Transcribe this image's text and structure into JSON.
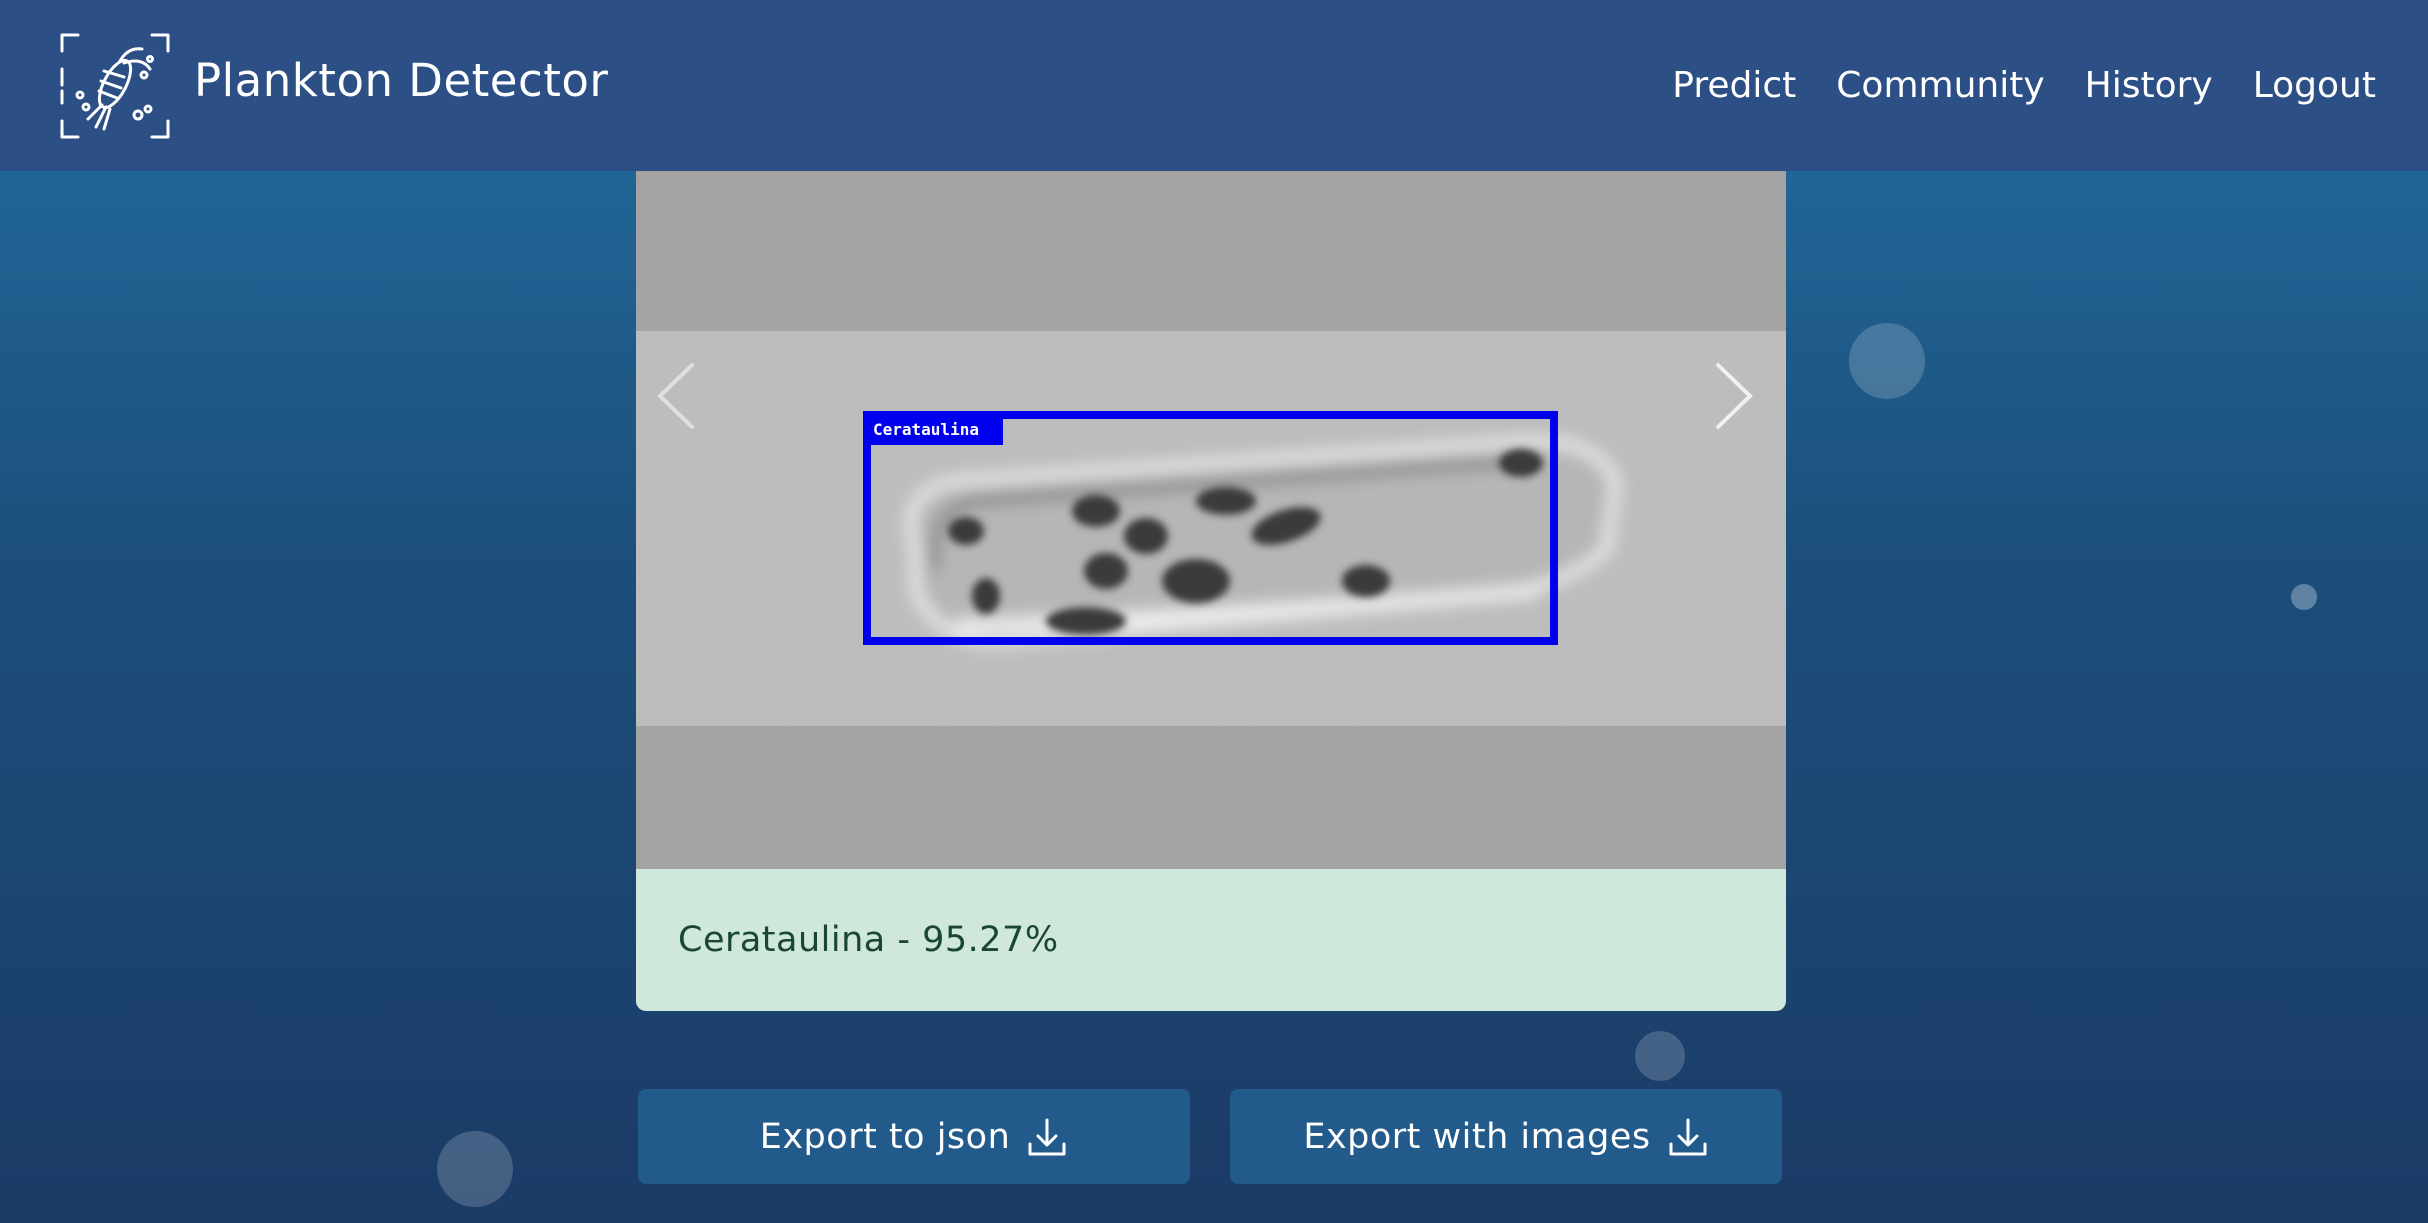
{
  "brand": {
    "title": "Plankton Detector",
    "logo_icon": "plankton-scan-icon"
  },
  "nav": {
    "items": [
      {
        "label": "Predict"
      },
      {
        "label": "Community"
      },
      {
        "label": "History"
      },
      {
        "label": "Logout"
      }
    ]
  },
  "carousel": {
    "detection_label": "Cerataulina",
    "prev_icon": "chevron-left-icon",
    "next_icon": "chevron-right-icon"
  },
  "result": {
    "text": "Cerataulina - 95.27%"
  },
  "actions": {
    "export_json_label": "Export to json",
    "export_images_label": "Export with images",
    "download_icon": "download-icon"
  },
  "colors": {
    "navbar": "#2c4f86",
    "background_top": "#236fa1",
    "background_bottom": "#1b3b66",
    "bbox": "#0000ee",
    "result_bg": "#d0e7dc",
    "result_text": "#1a4733",
    "button": "#225b8b"
  }
}
